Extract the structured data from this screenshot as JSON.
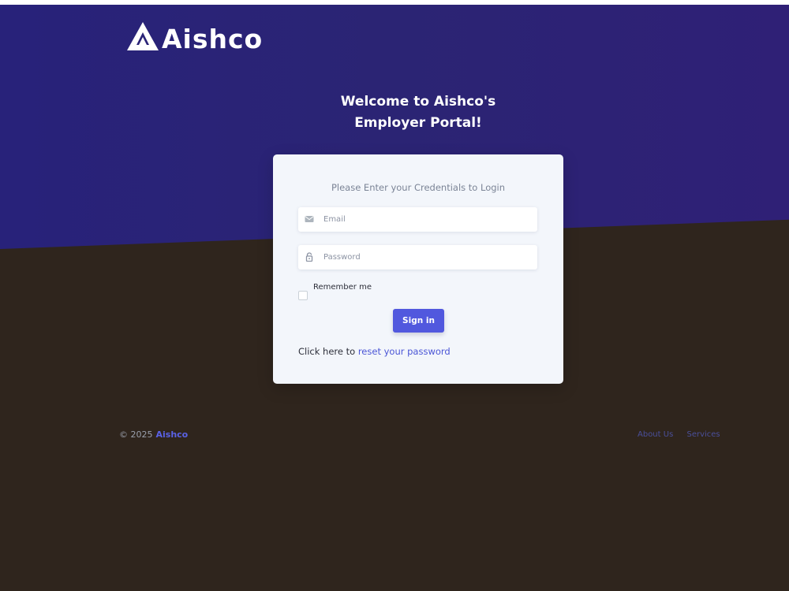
{
  "brand": {
    "logo_text": "Aishco"
  },
  "hero": {
    "title_line1": "Welcome to Aishco's",
    "title_line2": "Employer Portal!"
  },
  "login": {
    "subtitle": "Please Enter your Credentials to Login",
    "email": {
      "placeholder": "Email",
      "value": "",
      "icon": "envelope-icon"
    },
    "password": {
      "placeholder": "Password",
      "value": "",
      "icon": "lock-icon"
    },
    "remember_label": "Remember me",
    "remember_checked": false,
    "signin_label": "Sign in",
    "reset_prefix": "Click here to ",
    "reset_link": "reset your password"
  },
  "footer": {
    "copyright": "© 2025",
    "brand": "Aishco",
    "links": [
      "About Us",
      "Services"
    ]
  },
  "colors": {
    "hero_bg": "#2a2377",
    "page_bg": "#2f251d",
    "accent": "#5158de",
    "link": "#4a55d6",
    "card_bg": "#f3f6fb"
  }
}
